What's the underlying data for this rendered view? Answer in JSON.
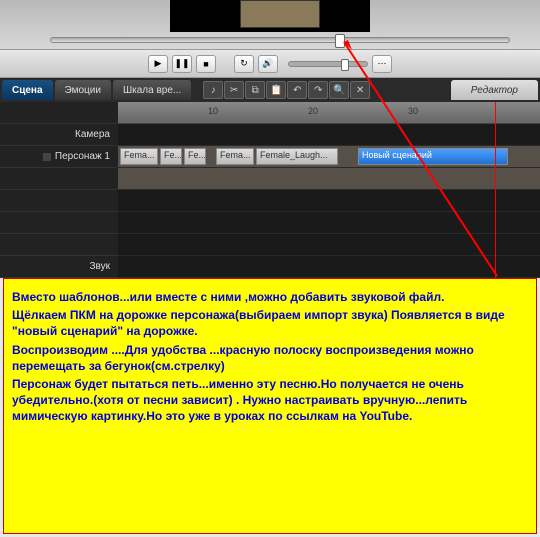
{
  "tabs": {
    "scene": "Сцена",
    "emotions": "Эмоции",
    "scale": "Шкала вре...",
    "editor": "Редактор"
  },
  "tracks": {
    "camera": "Камера",
    "character1": "Персонаж 1",
    "sound": "Звук"
  },
  "ruler": {
    "t10": "10",
    "t20": "20",
    "t30": "30"
  },
  "clips": {
    "c1": "Fema...",
    "c2": "Fe...",
    "c3": "Fe...",
    "c4": "Fema...",
    "c5": "Female_Laugh...",
    "scenario": "Новый сценарий"
  },
  "annotation": {
    "p1": "Вместо шаблонов...или вместе с ними ,можно добавить звуковой файл.",
    "p2": "Щёлкаем ПКМ на дорожке персонажа(выбираем импорт звука) Появляется в виде \"новый сценарий\" на дорожке.",
    "p3": "Воспроизводим ....Для удобства ...красную полоску воспроизведения можно перемещать за бегунок(см.стрелку)",
    "p4": "Персонаж будет пытаться петь...именно эту песню.Но получается не очень убедительно.(хотя от песни зависит) . Нужно настраивать вручную...лепить мимическую картинку.Но это уже в уроках по ссылкам на YouTube."
  }
}
